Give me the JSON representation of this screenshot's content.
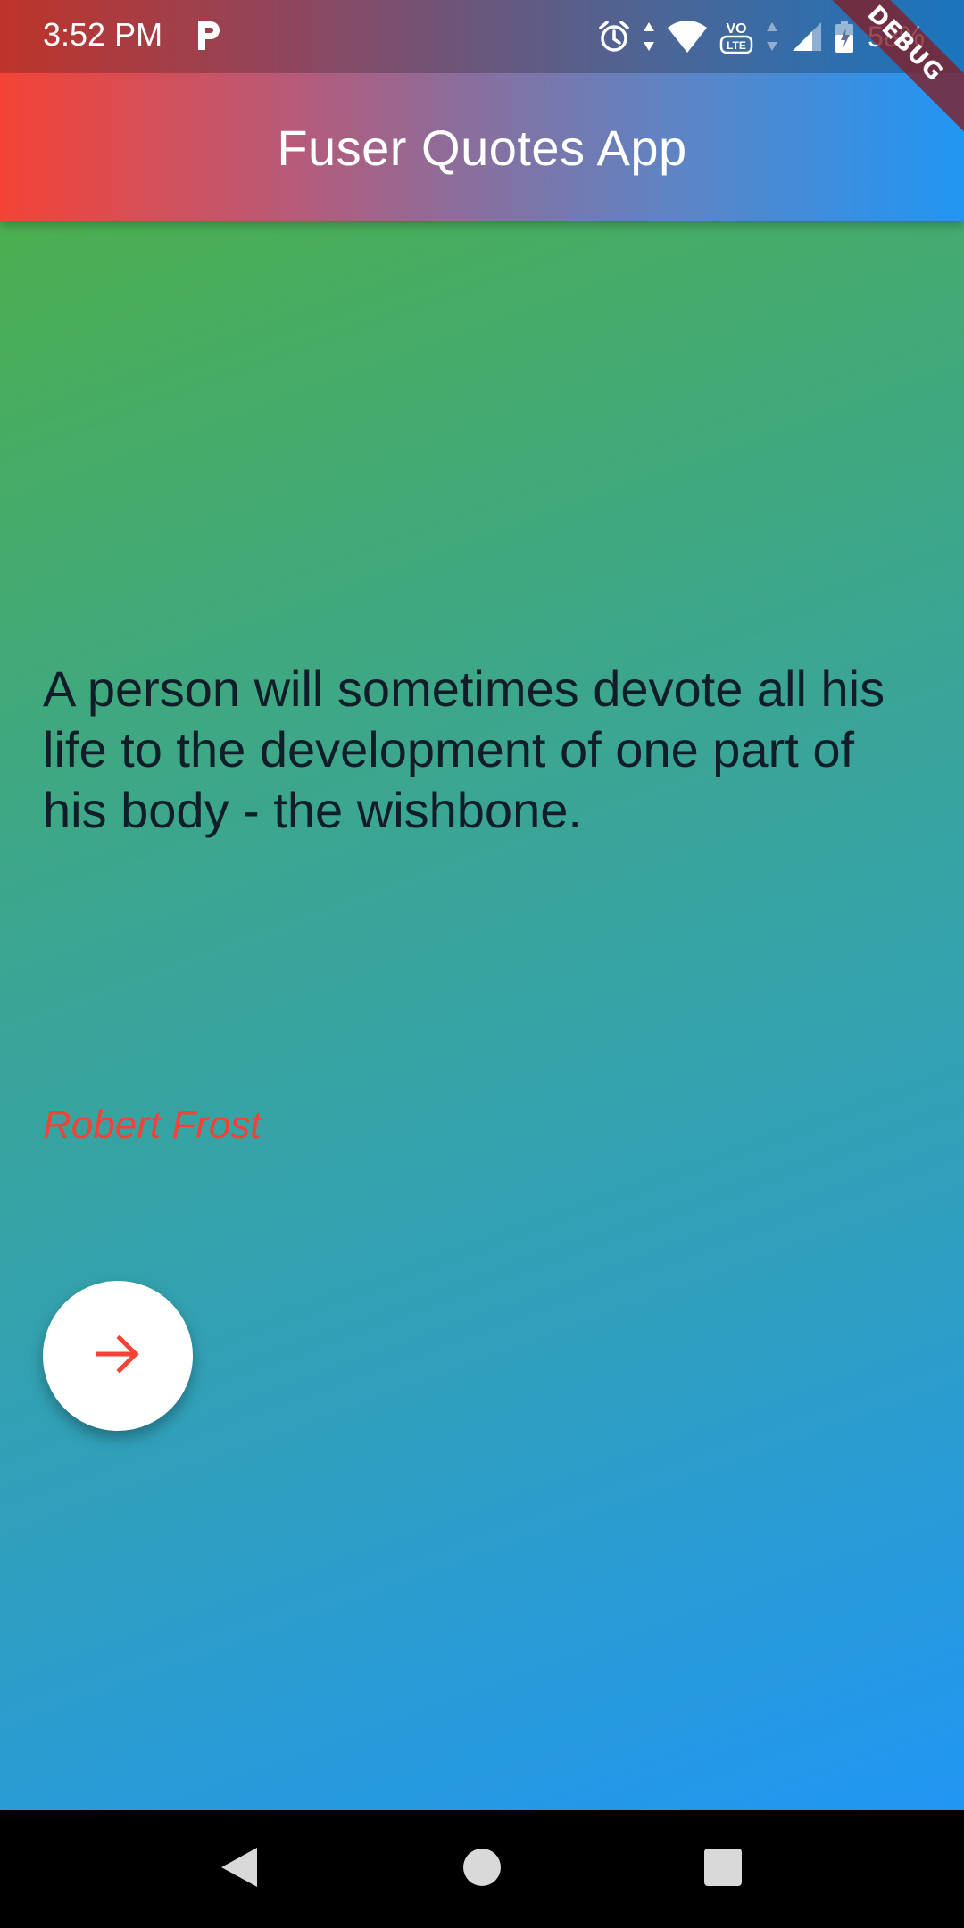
{
  "status_bar": {
    "time": "3:52 PM",
    "battery_percent": "58%",
    "icons": [
      "p-app-icon",
      "alarm-icon",
      "data-arrows-icon",
      "wifi-icon",
      "volte-icon",
      "signal-icon",
      "battery-icon"
    ],
    "volte_label": "VO",
    "lte_label": "LTE"
  },
  "app_bar": {
    "title": "Fuser Quotes App",
    "debug_label": "DEBUG"
  },
  "quote": {
    "text": "A person will sometimes devote all his life to the development of one part of his body - the wishbone.",
    "author": "Robert Frost"
  },
  "fab": {
    "icon": "arrow-right-icon"
  },
  "nav_bar": {
    "buttons": [
      "back-icon",
      "home-icon",
      "recents-icon"
    ]
  },
  "colors": {
    "appbar_start": "#F44336",
    "appbar_end": "#2196F3",
    "body_start": "#4CAF50",
    "body_end": "#2196F3",
    "author": "#F44336",
    "fab_icon": "#F44336",
    "quote_text": "#111D28"
  }
}
